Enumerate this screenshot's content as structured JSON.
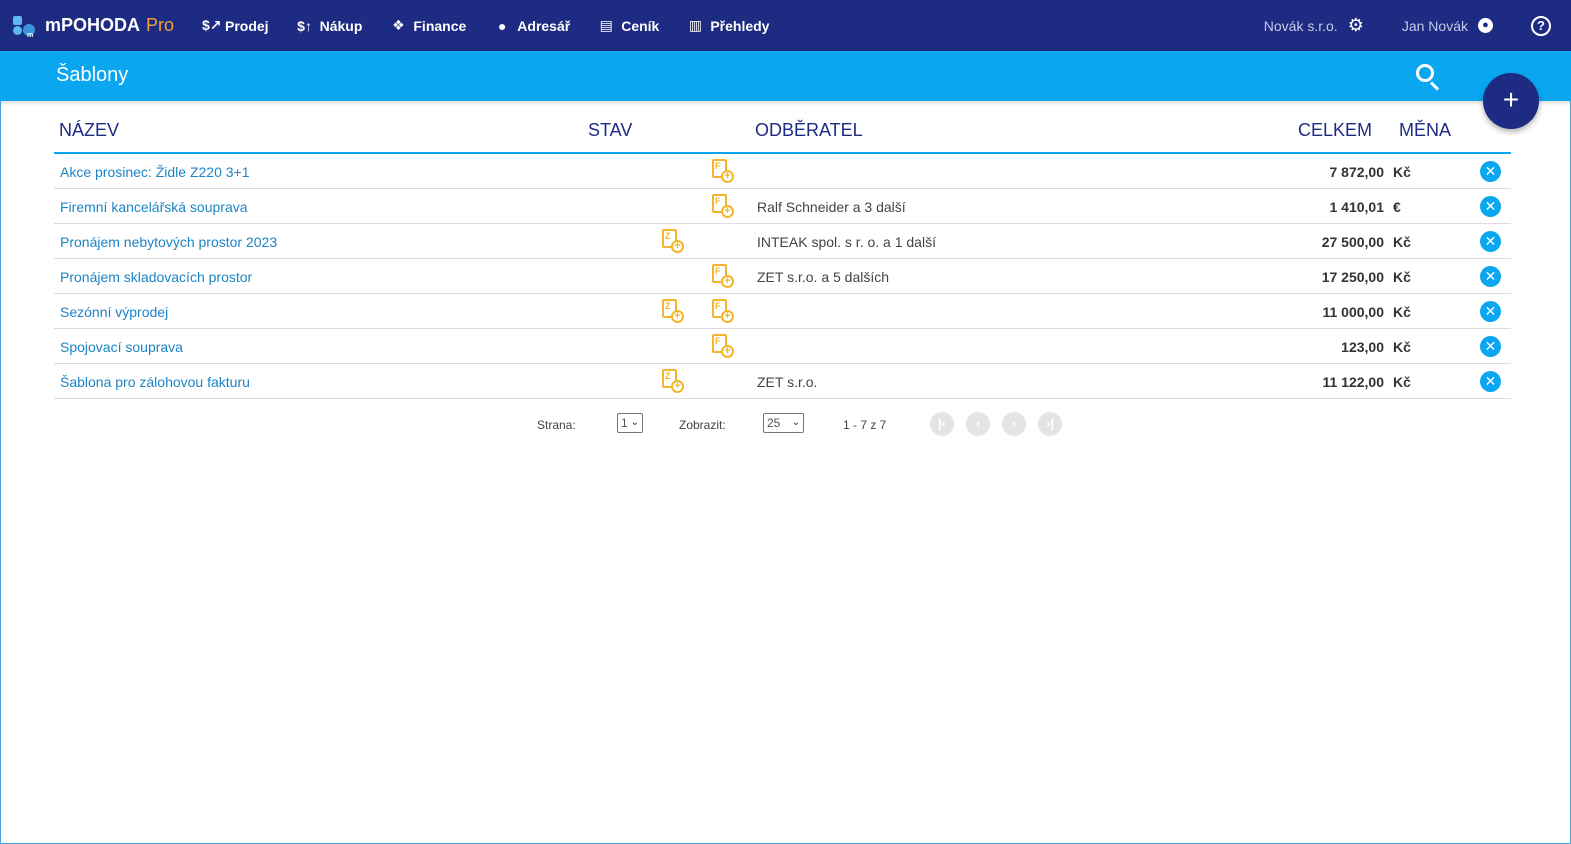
{
  "app": {
    "name": "mPOHODA",
    "edition": "Pro"
  },
  "nav": [
    {
      "label": "Prodej",
      "icon": "sales-icon"
    },
    {
      "label": "Nákup",
      "icon": "purchase-icon"
    },
    {
      "label": "Finance",
      "icon": "finance-icon"
    },
    {
      "label": "Adresář",
      "icon": "person-icon"
    },
    {
      "label": "Ceník",
      "icon": "clipboard-icon"
    },
    {
      "label": "Přehledy",
      "icon": "bar-chart-icon"
    }
  ],
  "header": {
    "company": "Novák s.r.o.",
    "user": "Jan Novák",
    "help": "?"
  },
  "page": {
    "title": "Šablony",
    "add": "+"
  },
  "table": {
    "columns": {
      "name": "NÁZEV",
      "status": "STAV",
      "customer": "ODBĚRATEL",
      "total": "CELKEM",
      "currency": "MĚNA"
    },
    "rows": [
      {
        "name": "Akce prosinec: Židle Z220 3+1",
        "customer": "",
        "total": "7 872,00",
        "currency": "Kč",
        "zdoc": false,
        "fdoc": true
      },
      {
        "name": "Firemní kancelářská souprava",
        "customer": "Ralf Schneider a 3 další",
        "total": "1 410,01",
        "currency": "€",
        "zdoc": false,
        "fdoc": true
      },
      {
        "name": "Pronájem nebytových prostor 2023",
        "customer": "INTEAK spol. s r. o. a 1 další",
        "total": "27 500,00",
        "currency": "Kč",
        "zdoc": true,
        "fdoc": false
      },
      {
        "name": "Pronájem skladovacích prostor",
        "customer": "ZET s.r.o. a 5 dalších",
        "total": "17 250,00",
        "currency": "Kč",
        "zdoc": false,
        "fdoc": true
      },
      {
        "name": "Sezónní výprodej",
        "customer": "",
        "total": "11 000,00",
        "currency": "Kč",
        "zdoc": true,
        "fdoc": true
      },
      {
        "name": "Spojovací souprava",
        "customer": "",
        "total": "123,00",
        "currency": "Kč",
        "zdoc": false,
        "fdoc": true
      },
      {
        "name": "Šablona pro zálohovou fakturu",
        "customer": "ZET s.r.o.",
        "total": "11 122,00",
        "currency": "Kč",
        "zdoc": true,
        "fdoc": false
      }
    ]
  },
  "pager": {
    "page_label": "Strana:",
    "page_value": "1",
    "show_label": "Zobrazit:",
    "show_value": "25",
    "range": "1 - 7 z 7"
  },
  "doc_letters": {
    "z": "Z",
    "f": "F"
  },
  "colors": {
    "nav": "#1e2b82",
    "accent": "#0ba6f0",
    "doc": "#f5b52a",
    "link": "#1c84c6"
  }
}
